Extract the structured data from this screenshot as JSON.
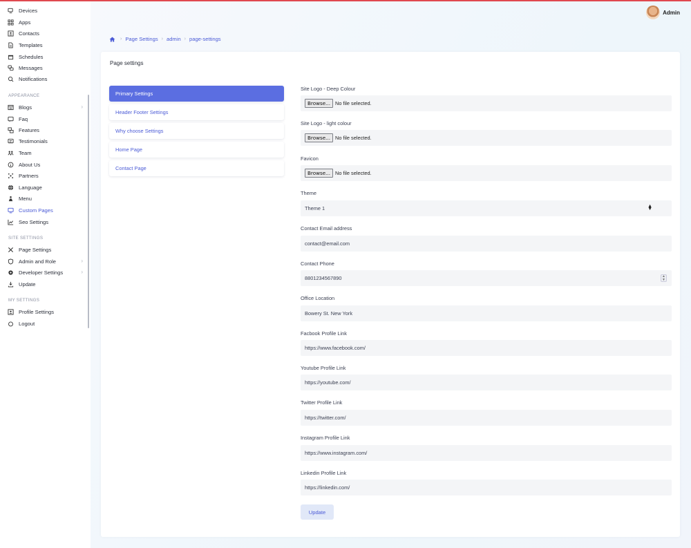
{
  "sidebar": {
    "items_top": [
      {
        "label": "Devices",
        "icon": "devices-icon"
      },
      {
        "label": "Apps",
        "icon": "apps-grid-icon"
      },
      {
        "label": "Contacts",
        "icon": "contacts-icon"
      },
      {
        "label": "Templates",
        "icon": "templates-icon"
      },
      {
        "label": "Schedules",
        "icon": "calendar-icon"
      },
      {
        "label": "Messages",
        "icon": "messages-icon"
      },
      {
        "label": "Notifications",
        "icon": "bell-icon"
      }
    ],
    "section_appearance": "APPEARANCE",
    "items_appearance": [
      {
        "label": "Blogs",
        "icon": "blogs-icon"
      },
      {
        "label": "Faq",
        "icon": "faq-icon"
      },
      {
        "label": "Features",
        "icon": "features-icon"
      },
      {
        "label": "Testimonials",
        "icon": "testimonials-icon"
      },
      {
        "label": "Team",
        "icon": "team-icon"
      },
      {
        "label": "About Us",
        "icon": "info-icon"
      },
      {
        "label": "Partners",
        "icon": "partners-icon"
      },
      {
        "label": "Language",
        "icon": "globe-icon"
      },
      {
        "label": "Menu",
        "icon": "menu-icon"
      },
      {
        "label": "Custom Pages",
        "icon": "custom-pages-icon"
      },
      {
        "label": "Seo Settings",
        "icon": "chart-icon"
      }
    ],
    "section_site": "SITE SETTINGS",
    "items_site": [
      {
        "label": "Page Settings",
        "icon": "tools-icon"
      },
      {
        "label": "Admin and Role",
        "icon": "shield-icon"
      },
      {
        "label": "Developer Settings",
        "icon": "gear-icon"
      },
      {
        "label": "Update",
        "icon": "download-icon"
      }
    ],
    "section_my": "MY SETTINGS",
    "items_my": [
      {
        "label": "Profile Settings",
        "icon": "profile-icon"
      },
      {
        "label": "Logout",
        "icon": "power-icon"
      }
    ]
  },
  "header": {
    "user_name": "Admin"
  },
  "breadcrumb": [
    "Page Settings",
    "admin",
    "page-settings"
  ],
  "card": {
    "title": "Page settings",
    "tabs": [
      "Primary Settings",
      "Header Footer Settings",
      "Why choose Settings",
      "Home Page",
      "Contact Page"
    ]
  },
  "form": {
    "logo_deep_label": "Site Logo - Deep Colour",
    "logo_light_label": "Site Logo - light colour",
    "favicon_label": "Favicon",
    "browse_label": "Browse...",
    "no_file": "No file selected.",
    "theme_label": "Theme",
    "theme_value": "Theme 1",
    "email_label": "Contact Email address",
    "email_value": "contact@email.com",
    "phone_label": "Contact Phone",
    "phone_value": "8801234567890",
    "location_label": "Office Location",
    "location_value": "Bowery St. New York",
    "facebook_label": "Facbook Profile Link",
    "facebook_value": "https://www.facebook.com/",
    "youtube_label": "Youtube Profile Link",
    "youtube_value": "https://youtube.com/",
    "twitter_label": "Twitter Profile Link",
    "twitter_value": "https://twitter.com/",
    "instagram_label": "Instagram Profile Link",
    "instagram_value": "https://www.instagram.com/",
    "linkedin_label": "Linkedin Profile Link",
    "linkedin_value": "https://linkedin.com/",
    "update_label": "Update"
  },
  "colors": {
    "accent": "#5b6ee1",
    "link": "#4b5bd6",
    "top_line": "#e0484f"
  }
}
